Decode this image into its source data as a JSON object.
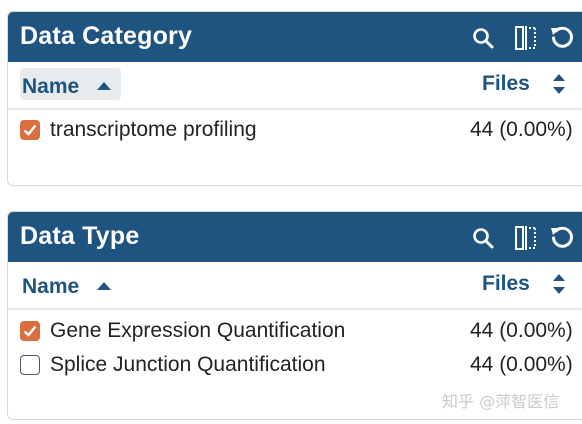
{
  "panels": [
    {
      "title": "Data Category",
      "name_header": "Name",
      "files_header": "Files",
      "rows": [
        {
          "label": "transcriptome profiling",
          "count": "44 (0.00%)",
          "checked": true
        }
      ]
    },
    {
      "title": "Data Type",
      "name_header": "Name",
      "files_header": "Files",
      "rows": [
        {
          "label": "Gene Expression Quantification",
          "count": "44 (0.00%)",
          "checked": true
        },
        {
          "label": "Splice Junction Quantification",
          "count": "44 (0.00%)",
          "checked": false
        }
      ]
    }
  ],
  "watermark": "知乎 @萍智医信",
  "icons": [
    "search-icon",
    "column-toggle-icon",
    "reset-icon",
    "sort-up-icon",
    "sort-both-icon",
    "checkmark-icon"
  ],
  "colors": {
    "header_bg": "#1f5380",
    "accent": "#d96f3f",
    "link": "#1f5380"
  }
}
